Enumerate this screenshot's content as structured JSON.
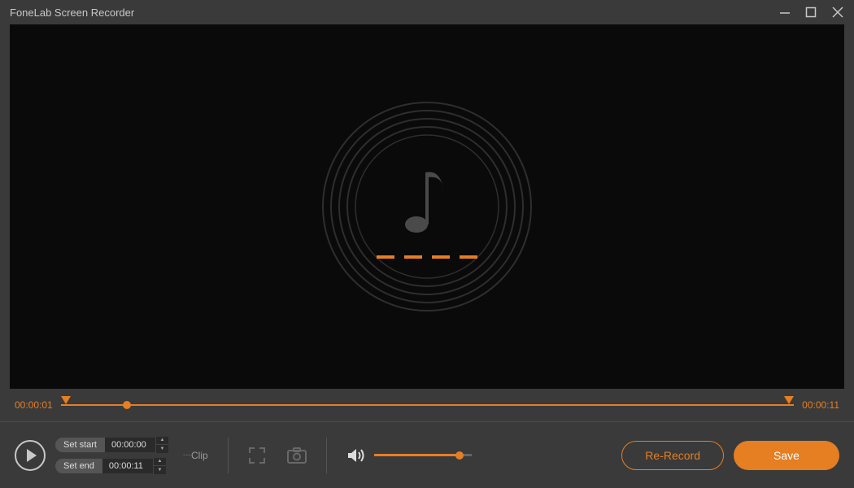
{
  "titlebar": {
    "app_title": "FoneLab Screen Recorder"
  },
  "timeline": {
    "start_time": "00:00:01",
    "end_time": "00:00:11",
    "playhead_percent": 9
  },
  "clip": {
    "set_start_label": "Set start",
    "set_start_value": "00:00:00",
    "set_end_label": "Set end",
    "set_end_value": "00:00:11",
    "clip_label": "Clip"
  },
  "volume": {
    "percent": 88
  },
  "actions": {
    "re_record_label": "Re-Record",
    "save_label": "Save"
  },
  "colors": {
    "accent": "#e67e22"
  }
}
